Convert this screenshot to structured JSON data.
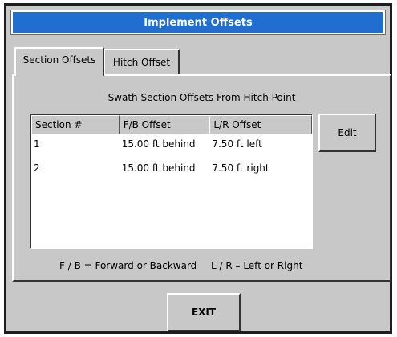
{
  "window": {
    "title": "Implement Offsets"
  },
  "tabs": [
    {
      "label": "Section Offsets",
      "active": true
    },
    {
      "label": "Hitch Offset",
      "active": false
    }
  ],
  "panel": {
    "title": "Swath Section Offsets From Hitch Point",
    "table": {
      "columns": [
        "Section #",
        "F/B Offset",
        "L/R Offset"
      ],
      "rows": [
        [
          "1",
          "15.00 ft behind",
          "7.50 ft left"
        ],
        [
          "2",
          "15.00 ft behind",
          "7.50 ft right"
        ]
      ]
    },
    "edit_label": "Edit",
    "legend_fb": "F / B = Forward or Backward",
    "legend_lr": "L / R – Left or Right"
  },
  "footer": {
    "exit_label": "EXIT"
  },
  "colors": {
    "titlebar": "#1f6ed0",
    "panel": "#c8c8c8"
  }
}
